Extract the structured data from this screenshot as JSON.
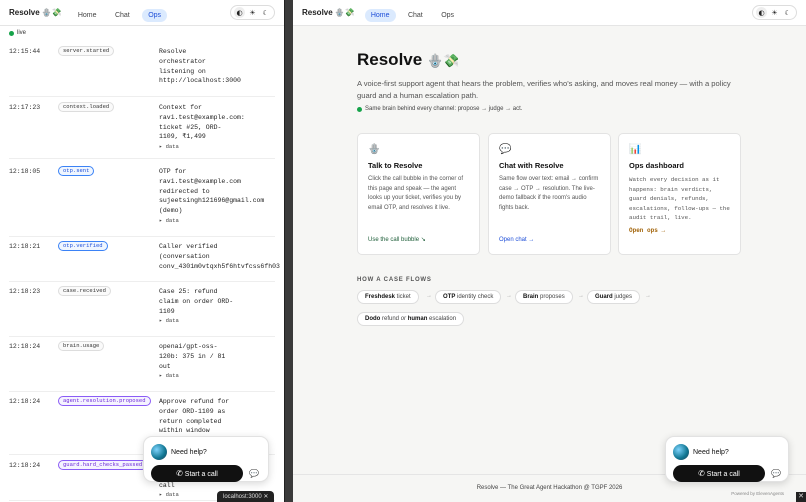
{
  "left": {
    "brand": "Resolve 🪬💸",
    "nav": [
      "Home",
      "Chat",
      "Ops"
    ],
    "themes": [
      "◐",
      "☀",
      "☾"
    ],
    "live": "live",
    "events": [
      {
        "time": "12:15:44",
        "type": "server.started",
        "style": "plain",
        "msg": "Resolve\norchestrator\nlistening on\nhttp://localhost:3000",
        "data": ""
      },
      {
        "time": "12:17:23",
        "type": "context.loaded",
        "style": "plain",
        "msg": "Context for\nravi.test@example.com:\nticket #25, ORD-\n1109, ₹1,499",
        "data": "▸ data"
      },
      {
        "time": "12:18:05",
        "type": "otp.sent",
        "style": "blue",
        "msg": "OTP for\nravi.test@example.com\nredirected to\nsujeetsingh121696@gmail.com\n(demo)",
        "data": "▸ data"
      },
      {
        "time": "12:18:21",
        "type": "otp.verified",
        "style": "blue",
        "msg": "Caller verified\n(conversation\nconv_4301m0vtqxh5f6htvfcss6fh03",
        "data": ""
      },
      {
        "time": "12:18:23",
        "type": "case.received",
        "style": "plain",
        "msg": "Case 25: refund\nclaim on order ORD-\n1109",
        "data": "▸ data"
      },
      {
        "time": "12:18:24",
        "type": "brain.usage",
        "style": "plain",
        "msg": "openai/gpt-oss-\n120b: 375 in / 81\nout",
        "data": "▸ data"
      },
      {
        "time": "12:18:24",
        "type": "agent.resolution.proposed",
        "style": "purple",
        "msg": "Approve refund for\norder ORD-1109 as\nreturn completed\nwithin window",
        "data": ""
      },
      {
        "time": "12:18:24",
        "type": "guard.hard_checks_passed",
        "style": "purple",
        "msg": "\n\ncall",
        "data": "▸ data"
      }
    ],
    "help": {
      "title": "Need help?",
      "call": "Start a call"
    },
    "url": "localhost:3000",
    "powered": "Power"
  },
  "right": {
    "brand": "Resolve 🪬💸",
    "nav": [
      "Home",
      "Chat",
      "Ops"
    ],
    "themes": [
      "◐",
      "☀",
      "☾"
    ],
    "title": "Resolve",
    "title_emoji": "🪬💸",
    "intro": "A voice-first support agent that hears the problem, verifies who's asking, and moves real money — with a policy guard and a human escalation path.",
    "brain": "Same brain behind every channel: propose → judge → act.",
    "cards": [
      {
        "icon": "🪬",
        "title": "Talk to Resolve",
        "body": "Click the call bubble in the corner of this page and speak — the agent looks up your ticket, verifies you by email OTP, and resolves it live.",
        "link": "Use the call bubble ↘",
        "linkstyle": "green",
        "mono": false
      },
      {
        "icon": "💬",
        "title": "Chat with Resolve",
        "body": "Same flow over text: email → confirm case → OTP → resolution. The live-demo fallback if the room's audio fights back.",
        "link": "Open chat →",
        "linkstyle": "blue",
        "mono": false
      },
      {
        "icon": "📊",
        "title": "Ops dashboard",
        "body": "Watch every decision as it happens: brain verdicts, guard denials, refunds, escalations, follow-ups — the audit trail, live.",
        "link": "Open ops →",
        "linkstyle": "mono",
        "mono": true
      }
    ],
    "flow_heading": "HOW A CASE FLOWS",
    "flow": [
      {
        "bold": "Freshdesk",
        "rest": " ticket"
      },
      {
        "bold": "OTP",
        "rest": " identity check"
      },
      {
        "bold": "Brain",
        "rest": " proposes"
      },
      {
        "bold": "Guard",
        "rest": " judges"
      },
      {
        "bold": "Dodo",
        "rest": " refund or human escalation"
      }
    ],
    "footer": "Resolve — The Great Agent Hackathon @ TGPF 2026",
    "help": {
      "title": "Need help?",
      "call": "Start a call"
    },
    "powered": "Powered by ElevenAgents"
  },
  "colors": {
    "accent": "#1d4ed8",
    "live": "#16a34a",
    "button": "#111111"
  }
}
